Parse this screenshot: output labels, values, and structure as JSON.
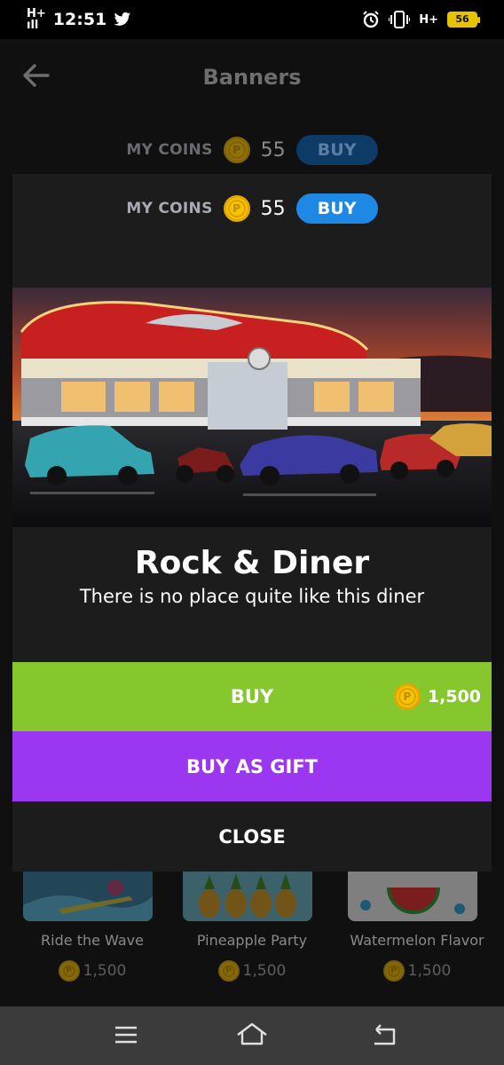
{
  "status_bar": {
    "time": "12:51",
    "network": "H+",
    "battery": "56",
    "icons": [
      "signal-icon",
      "twitter-icon",
      "alarm-icon",
      "vibrate-icon",
      "network-icon",
      "battery-icon"
    ]
  },
  "header": {
    "title": "Banners",
    "back_icon": "arrow-left-icon"
  },
  "coins": {
    "label": "MY COINS",
    "value": "55",
    "buy_label": "BUY",
    "coin_symbol": "P"
  },
  "modal": {
    "title": "Rock & Diner",
    "subtitle": "There is no place quite like this diner",
    "buy_label": "BUY",
    "price": "1,500",
    "gift_label": "BUY AS GIFT",
    "close_label": "CLOSE"
  },
  "grid": {
    "items": [
      {
        "name": "Ride the Wave",
        "price": "1,500"
      },
      {
        "name": "Pineapple Party",
        "price": "1,500"
      },
      {
        "name": "Watermelon Flavor",
        "price": "1,500"
      }
    ]
  },
  "nav": {
    "icons": [
      "menu-icon",
      "home-icon",
      "back-icon"
    ]
  },
  "colors": {
    "buy_green": "#86c72d",
    "gift_purple": "#9b37f0",
    "pill_blue": "#1e88e5",
    "coin_gold": "#f5c400",
    "modal_bg": "#1c1c1c"
  }
}
